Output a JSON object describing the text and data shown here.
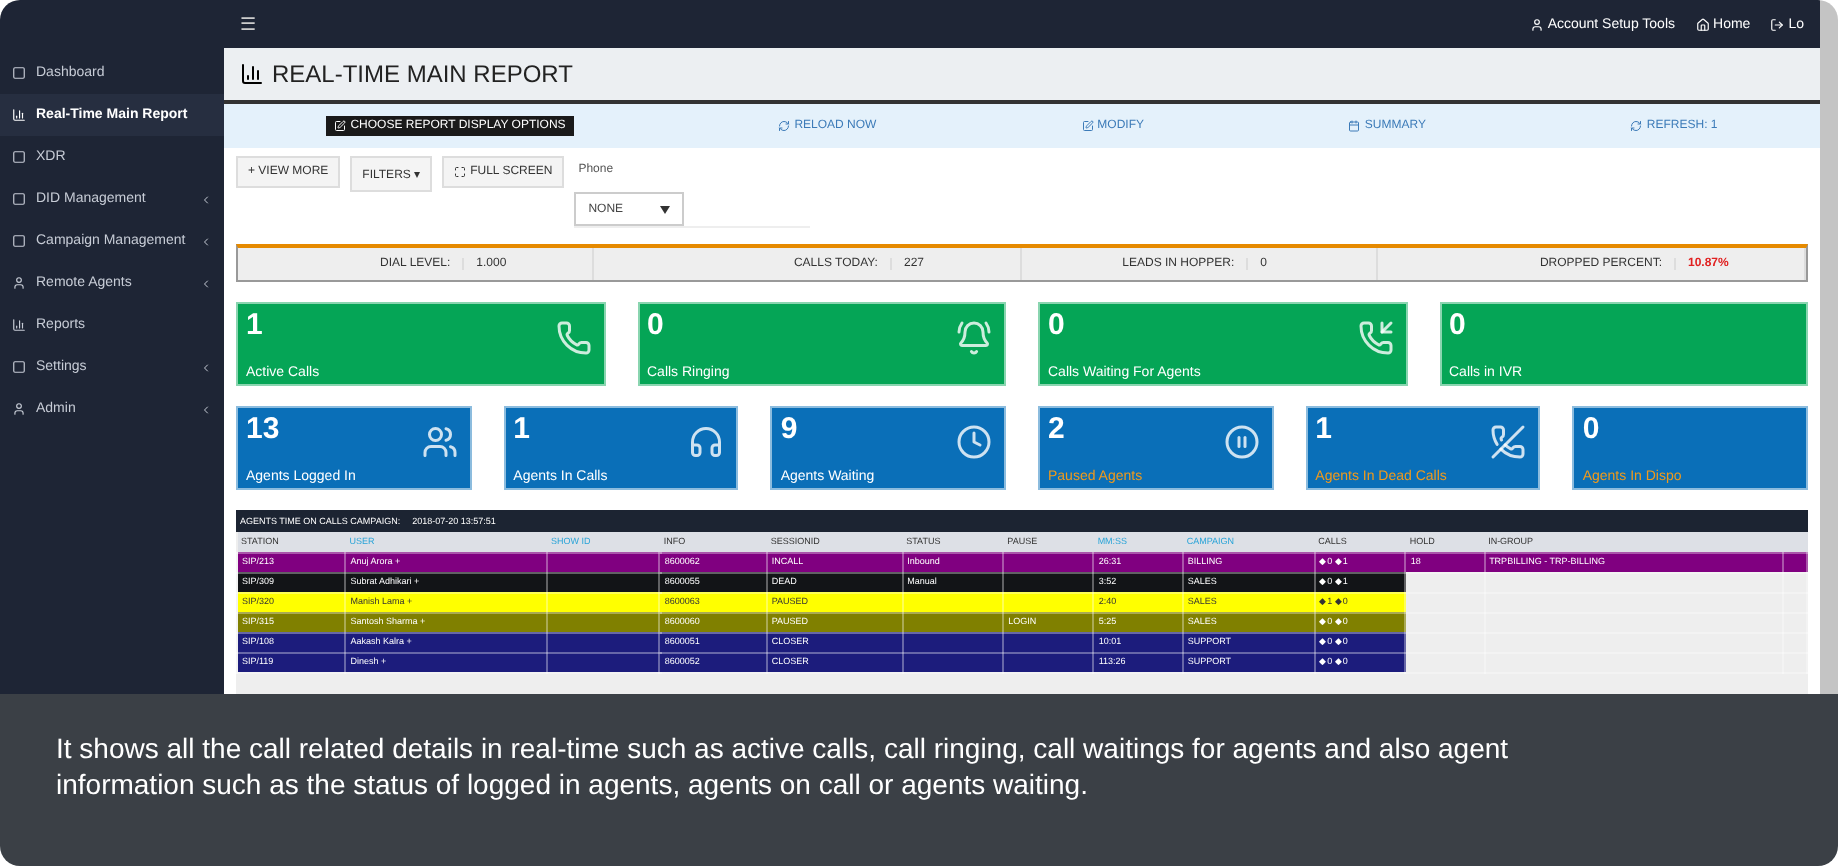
{
  "sidebar": {
    "items": [
      {
        "label": "Dashboard",
        "selected": false,
        "submenu": false
      },
      {
        "label": "Real-Time Main Report",
        "selected": true,
        "submenu": false
      },
      {
        "label": "XDR",
        "selected": false,
        "submenu": false
      },
      {
        "label": "DID Management",
        "selected": false,
        "submenu": true
      },
      {
        "label": "Campaign Management",
        "selected": false,
        "submenu": true
      },
      {
        "label": "Remote Agents",
        "selected": false,
        "submenu": true
      },
      {
        "label": "Reports",
        "selected": false,
        "submenu": false
      },
      {
        "label": "Settings",
        "selected": false,
        "submenu": true
      },
      {
        "label": "Admin",
        "selected": false,
        "submenu": true
      }
    ]
  },
  "top_bar": {
    "menu_glyph": "☰",
    "links": [
      "Account Setup Tools",
      "Home",
      "Lo"
    ]
  },
  "title": "REAL-TIME MAIN REPORT",
  "options_bar": {
    "choose": "CHOOSE REPORT DISPLAY OPTIONS",
    "links": [
      "RELOAD NOW",
      "MODIFY",
      "SUMMARY",
      "REFRESH: 1"
    ]
  },
  "toolbar": {
    "buttons": [
      "+ VIEW MORE",
      "FILTERS ▾",
      "FULL SCREEN"
    ],
    "phone_label": "Phone",
    "phone_select": "NONE"
  },
  "stats": [
    {
      "label": "DIAL LEVEL:",
      "value": "1.000",
      "alert": false
    },
    {
      "label": "CALLS TODAY:",
      "value": "227",
      "alert": false
    },
    {
      "label": "LEADS IN HOPPER:",
      "value": "0",
      "alert": false
    },
    {
      "label": "DROPPED PERCENT:",
      "value": "10.87%",
      "alert": true
    }
  ],
  "call_tiles": [
    {
      "value": "1",
      "label": "Active Calls",
      "warning": false
    },
    {
      "value": "0",
      "label": "Calls Ringing",
      "warning": false
    },
    {
      "value": "0",
      "label": "Calls Waiting For Agents",
      "warning": false
    },
    {
      "value": "0",
      "label": "Calls in IVR",
      "warning": false
    }
  ],
  "agent_tiles": [
    {
      "value": "13",
      "label": "Agents Logged In",
      "warning": false
    },
    {
      "value": "1",
      "label": "Agents In Calls",
      "warning": false
    },
    {
      "value": "9",
      "label": "Agents Waiting",
      "warning": false
    },
    {
      "value": "2",
      "label": "Paused Agents",
      "warning": true
    },
    {
      "value": "1",
      "label": "Agents In Dead Calls",
      "warning": true
    },
    {
      "value": "0",
      "label": "Agents In Dispo",
      "warning": true
    }
  ],
  "table": {
    "title": "AGENTS TIME ON CALLS CAMPAIGN:",
    "timestamp": "2018-07-20 13:57:51",
    "columns": [
      {
        "label": "STATION",
        "link": false
      },
      {
        "label": "USER",
        "link": true
      },
      {
        "label": "SHOW ID",
        "link": true
      },
      {
        "label": "INFO",
        "link": false
      },
      {
        "label": "SESSIONID",
        "link": false
      },
      {
        "label": "STATUS",
        "link": false
      },
      {
        "label": "PAUSE",
        "link": false
      },
      {
        "label": "MM:SS",
        "link": true
      },
      {
        "label": "CAMPAIGN",
        "link": true
      },
      {
        "label": "CALLS",
        "link": false
      },
      {
        "label": "HOLD",
        "link": false
      },
      {
        "label": "IN-GROUP",
        "link": false
      }
    ],
    "rows": [
      {
        "color": "#800080",
        "station": "SIP/213",
        "user": "Anuj Arora +",
        "session": "8600062",
        "status": "INCALL",
        "type": "Inbound",
        "pause": "",
        "time": "26:31",
        "campaign": "BILLING",
        "calls": "◆0 ◆1",
        "hold": "18",
        "ingroup": "TRPBILLING - TRP-BILLING"
      },
      {
        "color": "#121417",
        "station": "SIP/309",
        "user": "Subrat Adhikari +",
        "session": "8600055",
        "status": "DEAD",
        "type": "Manual",
        "pause": "",
        "time": "3:52",
        "campaign": "SALES",
        "calls": "◆0 ◆1",
        "hold": "",
        "ingroup": ""
      },
      {
        "color": "#ffff00",
        "station": "SIP/320",
        "user": "Manish Lama +",
        "session": "8600063",
        "status": "PAUSED",
        "type": "",
        "pause": "",
        "time": "2:40",
        "campaign": "SALES",
        "calls": "◆1 ◆0",
        "hold": "",
        "ingroup": ""
      },
      {
        "color": "#808000",
        "station": "SIP/315",
        "user": "Santosh Sharma +",
        "session": "8600060",
        "status": "PAUSED",
        "type": "",
        "pause": "LOGIN",
        "time": "5:25",
        "campaign": "SALES",
        "calls": "◆0 ◆0",
        "hold": "",
        "ingroup": ""
      },
      {
        "color": "#1c1c7c",
        "station": "SIP/108",
        "user": "Aakash Kalra +",
        "session": "8600051",
        "status": "CLOSER",
        "type": "",
        "pause": "",
        "time": "10:01",
        "campaign": "SUPPORT",
        "calls": "◆0 ◆0",
        "hold": "",
        "ingroup": ""
      },
      {
        "color": "#1c1c7c",
        "station": "SIP/119",
        "user": "Dinesh +",
        "session": "8600052",
        "status": "CLOSER",
        "type": "",
        "pause": "",
        "time": "113:26",
        "campaign": "SUPPORT",
        "calls": "◆0 ◆0",
        "hold": "",
        "ingroup": ""
      }
    ]
  },
  "caption": "It shows all the call related details in real-time such as active calls, call ringing, call waitings for agents and also agent information such as the status of logged in agents, agents on call or agents waiting."
}
